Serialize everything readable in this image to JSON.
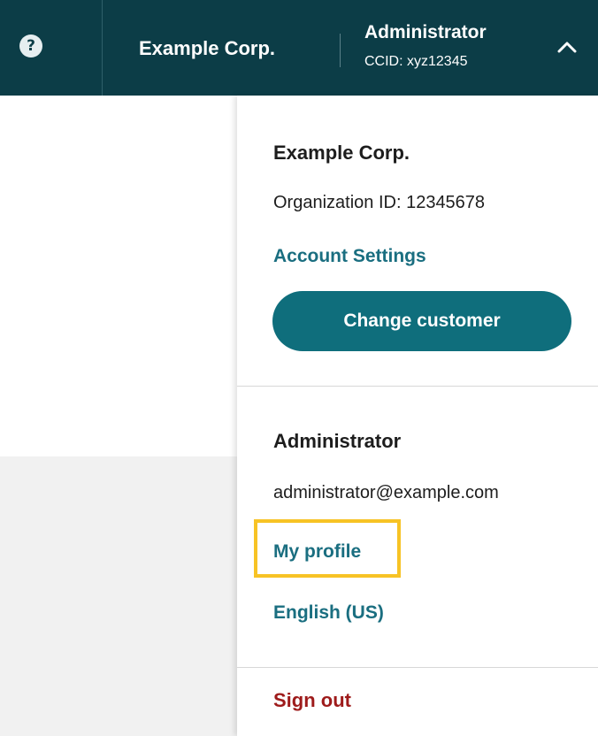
{
  "header": {
    "help_icon_glyph": "?",
    "org_name": "Example Corp.",
    "user_role": "Administrator",
    "ccid": "CCID: xyz12345",
    "bg_color": "#0c3d47"
  },
  "dropdown": {
    "org": {
      "name": "Example Corp.",
      "organization_id": "Organization ID: 12345678",
      "account_settings": "Account Settings",
      "change_customer": "Change customer"
    },
    "user": {
      "role": "Administrator",
      "email": "administrator@example.com",
      "my_profile": "My profile",
      "language": "English (US)"
    },
    "sign_out": "Sign out"
  },
  "colors": {
    "accent": "#0f6e7c",
    "link": "#1a6e80",
    "danger": "#9e1b1b",
    "highlight": "#f7c325"
  },
  "icons": [
    "help-icon",
    "chevron-up-icon"
  ]
}
